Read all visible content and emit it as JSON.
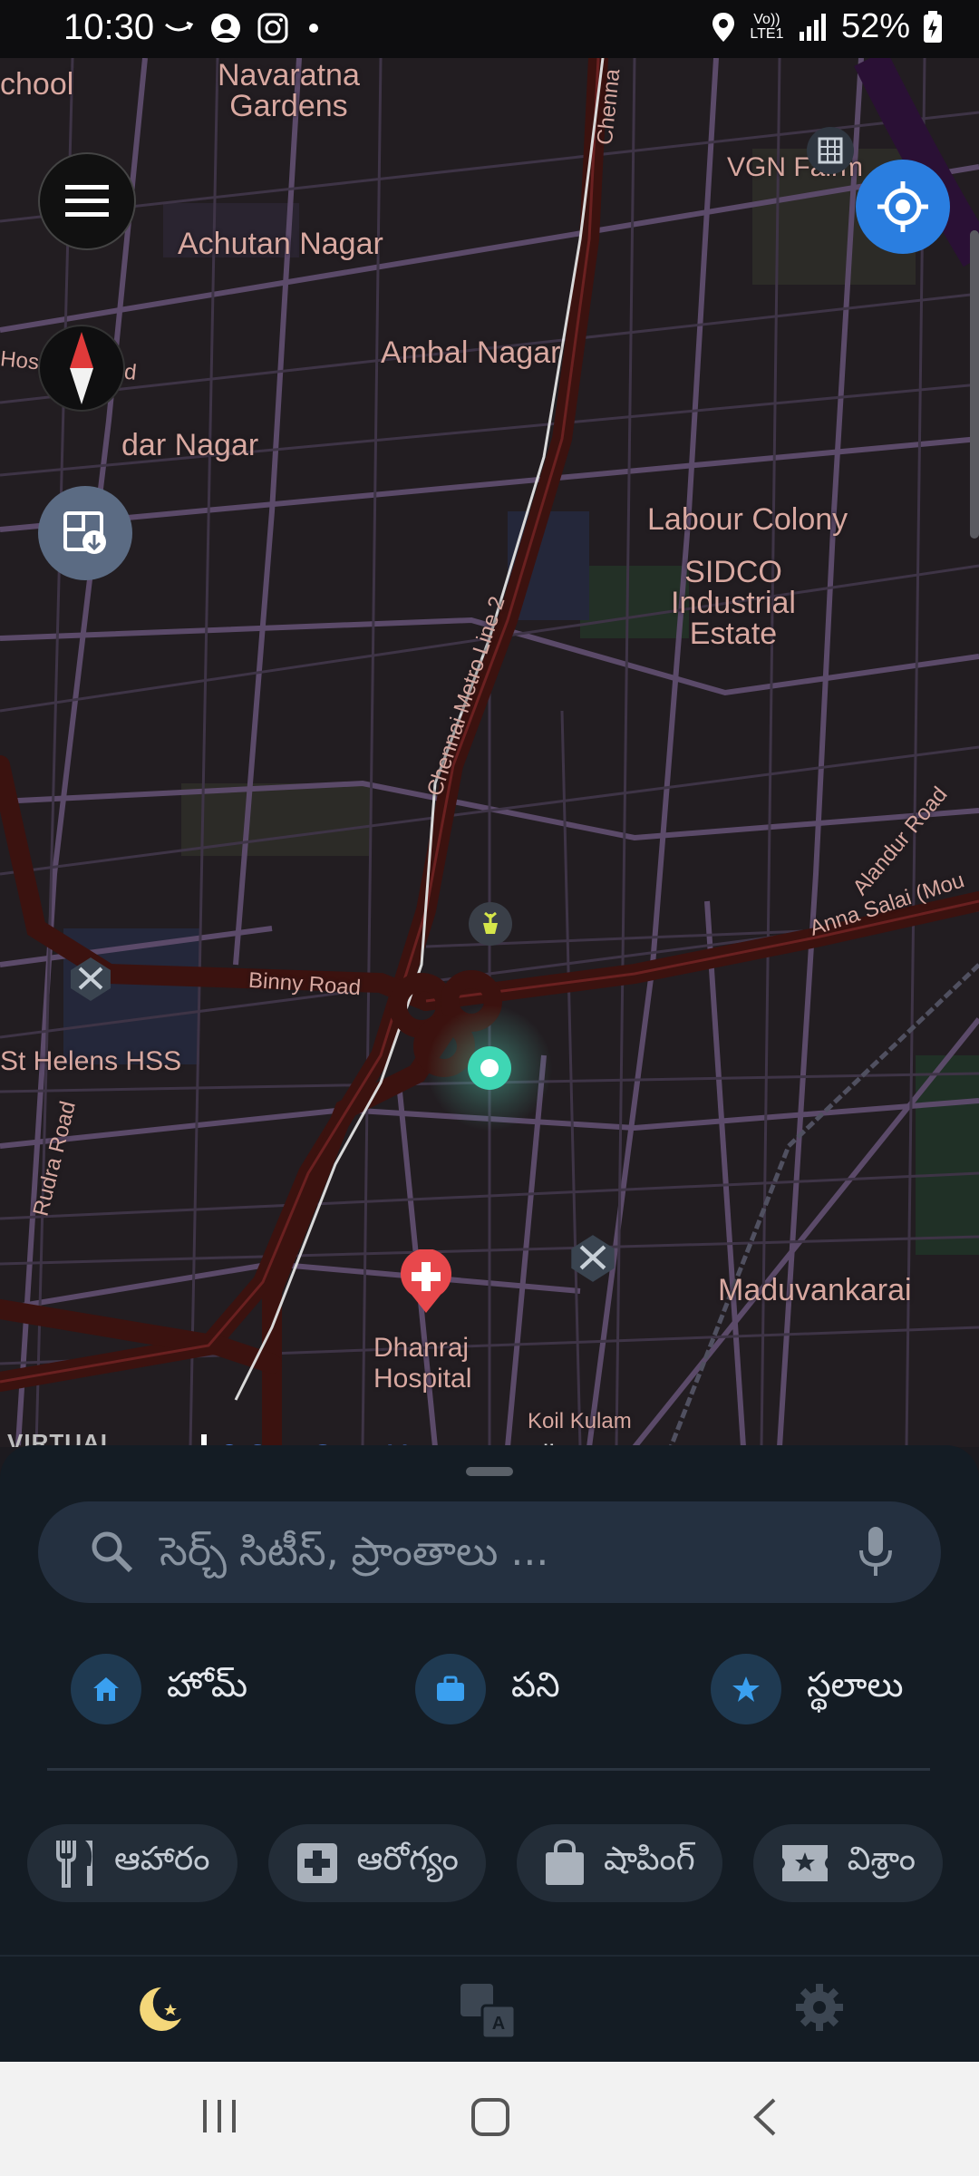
{
  "status_bar": {
    "time": "10:30",
    "network": "Vo)) LTE1",
    "battery": "52%"
  },
  "map": {
    "labels": {
      "school": "chool",
      "navaratna": "Navaratna\nGardens",
      "achutan": "Achutan Nagar",
      "ambal": "Ambal Nagar",
      "dar_nagar": "dar Nagar",
      "hospital_road": "Hospital Road",
      "vgn": "VGN Fairm",
      "labour": "Labour Colony",
      "sidco": "SIDCO\nIndustrial\nEstate",
      "metro": "Chennai Metro Line 2",
      "chenna": "Chenna",
      "alandur": "Alandur Road",
      "anna_salai": "Anna Salai (Mou",
      "binny": "Binny Road",
      "st_helens": "St Helens HSS",
      "rudra": "Rudra Road",
      "maduvankarai": "Maduvankarai",
      "dhanraj": "Dhanraj\nHospital",
      "koil": "Koil Kulam"
    },
    "attribution": {
      "logo": "VIRTUAL\nMAZE",
      "osm_link": "© OpenStreetMap",
      "contributors": "contributors"
    }
  },
  "sheet": {
    "search_placeholder": "సెర్చ్ సిటీస్, ప్రాంతాలు ...",
    "quick": [
      {
        "label": "హోమ్",
        "icon": "home-icon"
      },
      {
        "label": "పని",
        "icon": "briefcase-icon"
      },
      {
        "label": "స్థలాలు",
        "icon": "star-icon"
      }
    ],
    "categories": [
      {
        "label": "ఆహారం",
        "icon": "fork-knife-icon"
      },
      {
        "label": "ఆరోగ్యం",
        "icon": "medical-cross-icon"
      },
      {
        "label": "షాపింగ్",
        "icon": "shopping-bag-icon"
      },
      {
        "label": "విశ్రాం",
        "icon": "ticket-star-icon"
      }
    ]
  },
  "colors": {
    "accent": "#2a7ee0",
    "sheet": "#141c24",
    "map_bg": "#221d21",
    "road_main": "#3a1210",
    "road_minor": "#5c4a6a"
  }
}
